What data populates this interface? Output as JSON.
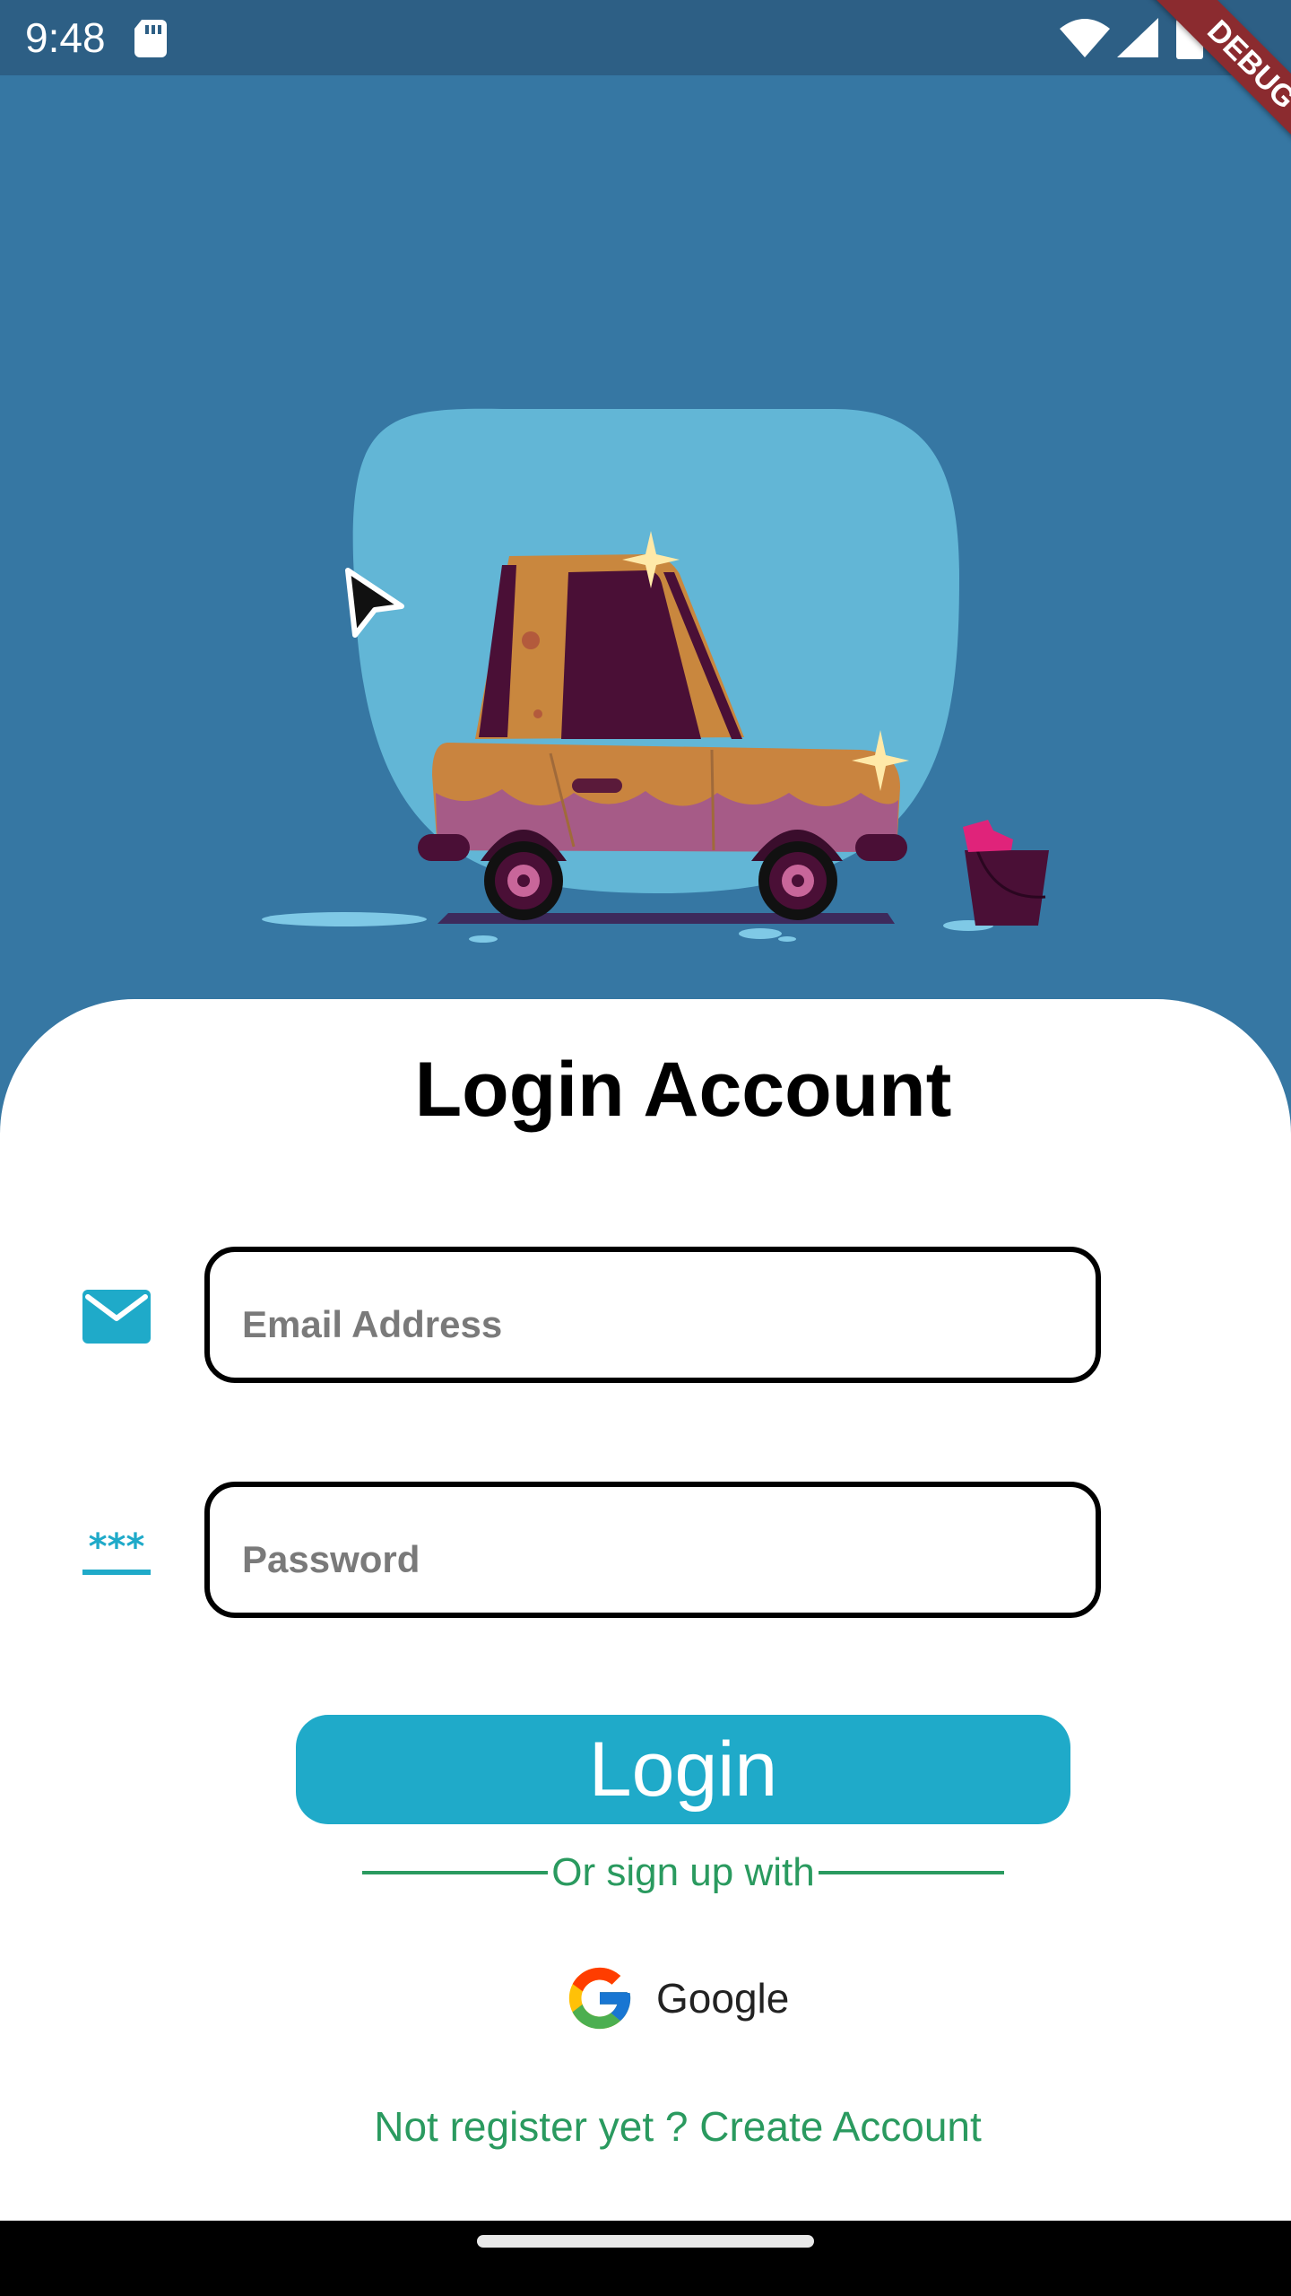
{
  "status_bar": {
    "time": "9:48",
    "icons": [
      "sd-card-icon",
      "wifi-icon",
      "signal-icon",
      "battery-icon"
    ]
  },
  "debug_banner": "DEBUG",
  "hero": {
    "illustration": "car-wash-illustration",
    "colors": {
      "background": "#3677a3",
      "blob": "#62b6d6"
    }
  },
  "login": {
    "title": "Login Account",
    "email": {
      "icon": "mail-icon",
      "placeholder": "Email Address",
      "value": ""
    },
    "password": {
      "icon": "password-icon",
      "placeholder": "Password",
      "value": ""
    },
    "login_button": "Login",
    "divider_text": "Or sign up with",
    "google_label": "Google",
    "register_link": "Not register yet ? Create Account"
  },
  "colors": {
    "accent": "#1faac9",
    "link_green": "#2a9a5f",
    "status_bar": "#2d5f85",
    "debug_ribbon": "#8b2b2f"
  }
}
